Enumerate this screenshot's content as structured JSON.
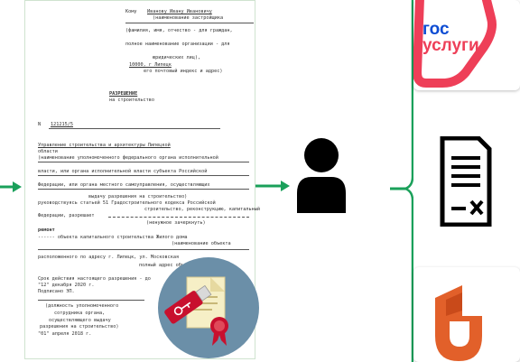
{
  "document": {
    "to_lines": [
      {
        "k": "to_label",
        "text": "Кому"
      },
      {
        "k": "to_name",
        "text": "Иванову Ивану Ивановичу"
      },
      {
        "k": "to_hint1",
        "text": "(наименование застройщика"
      },
      {
        "k": "to_hint2",
        "text": "(фамилия, имя, отчество - для граждан,"
      },
      {
        "k": "to_hint3",
        "text": "полное наименование организации - для"
      },
      {
        "k": "to_hint4",
        "text": "юридических лиц),"
      },
      {
        "k": "to_addr",
        "text": "10000, г Липецк"
      },
      {
        "k": "to_hint5",
        "text": "его почтовый индекс и адрес)"
      }
    ],
    "title": "РАЗРЕШЕНИЕ",
    "subtitle": "на строительство",
    "number_label": "N",
    "number_value": "121215/5",
    "body_lines": [
      "Управление строительства и архитектуры Липецкой",
      "области",
      "(наименование уполномоченного федерального органа исполнительной",
      "власти, или органа исполнительной власти субъекта Российской",
      "Федерации, или органа местного самоуправления, осуществляющих",
      "выдачу разрешения на строительство)",
      "руководствуясь статьей 51 Градостроительного кодекса    Российской",
      "строительство, реконструкцию, капитальный",
      "Федерации, разрешает",
      "(ненужное зачеркнуть)",
      "ремонт",
      "------ объекта капитального строительства   Жилого дома",
      "(наименование объекта",
      "расположенного по адресу    г. Липецк, ул. Московская",
      "полный адрес объекта",
      "Срок действия настоящего разрешения - до",
      "\"12\" декабря 2020 г.",
      "Подписано ЭП.",
      "(должность уполномоченного",
      "сотрудника органа,",
      "осуществляющего выдачу",
      "разрешения на строительство)",
      "\"01\" апреля 2018    г."
    ]
  },
  "services": {
    "gosuslugi_line1": "гос",
    "gosuslugi_line2": "услуги"
  },
  "colors": {
    "arrow": "#1aa05a",
    "bracket": "#1aa05a",
    "gosuslugi_red": "#ee3f58",
    "gosuslugi_blue": "#0d4cd3",
    "mfc_orange": "#e2602a",
    "person": "#000000",
    "usb": "#c8102e",
    "circle": "#6b8fa8"
  },
  "icons": [
    "person-icon",
    "document-sign-icon",
    "gosuslugi-logo",
    "mfc-logo",
    "usb-key-icon",
    "certificate-icon"
  ]
}
